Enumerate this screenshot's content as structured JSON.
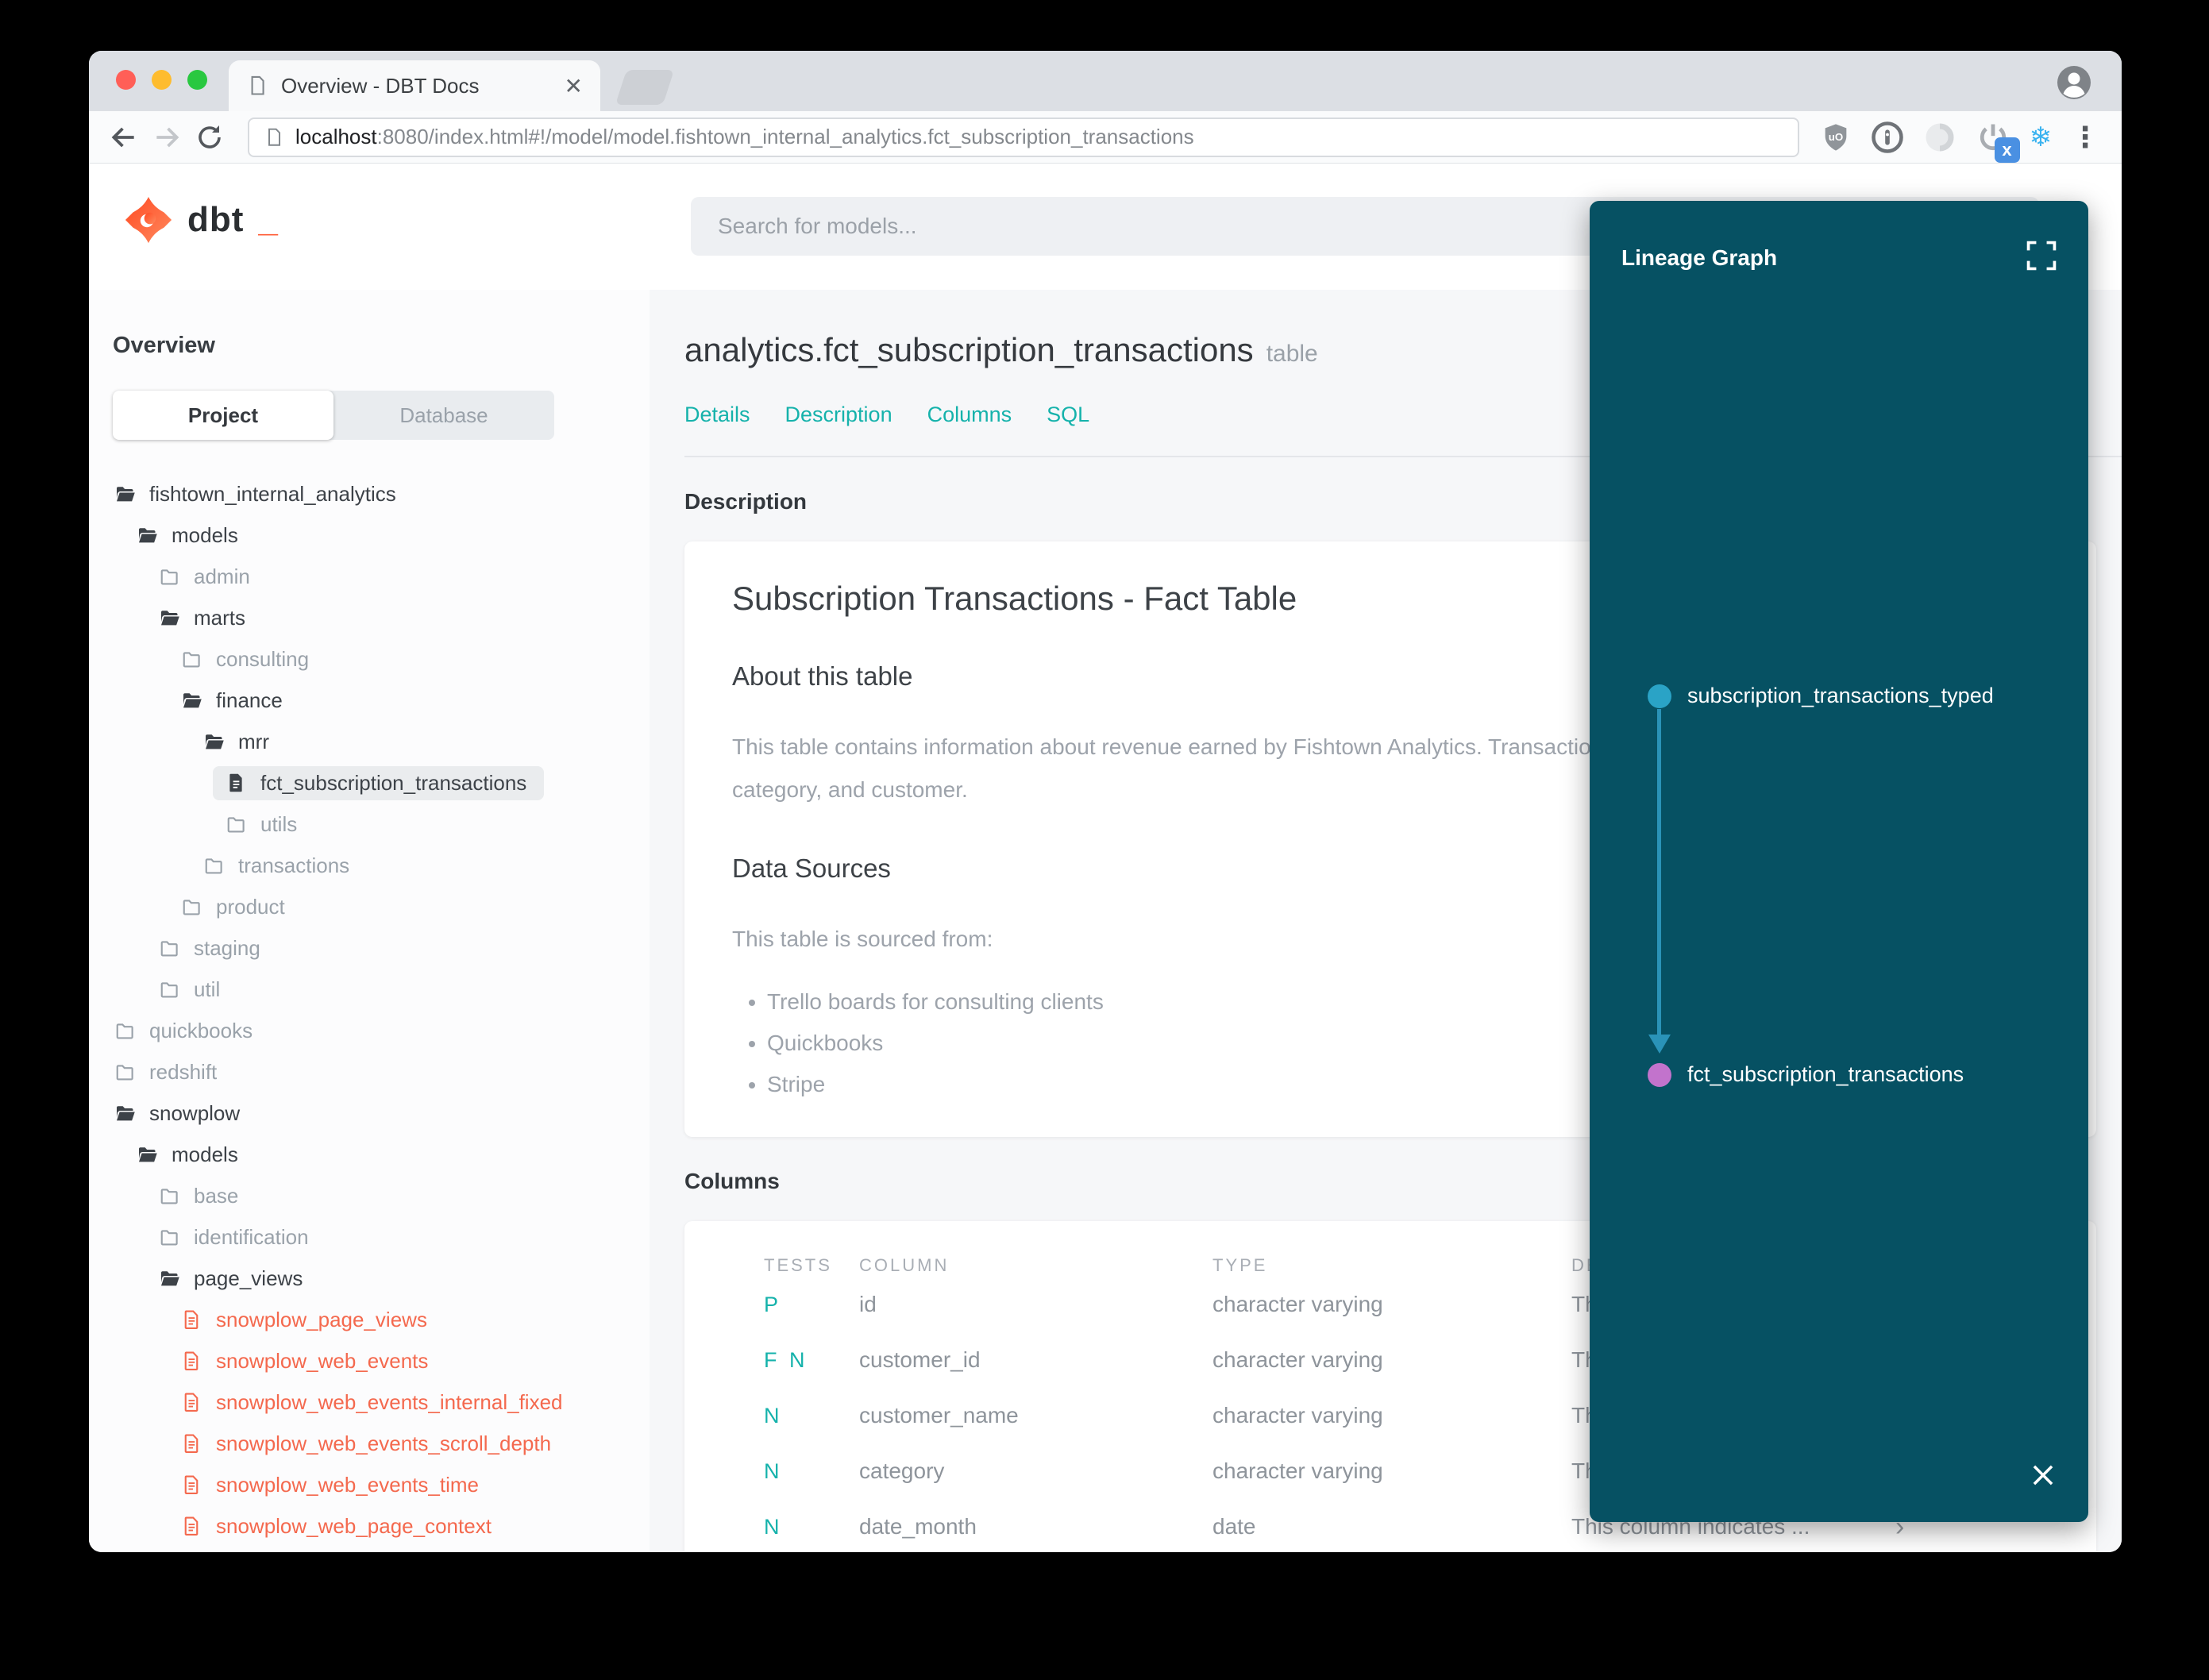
{
  "browser": {
    "tab_title": "Overview - DBT Docs",
    "url_host": "localhost",
    "url_rest": ":8080/index.html#!/model/model.fishtown_internal_analytics.fct_subscription_transactions"
  },
  "header": {
    "logo_text": "dbt",
    "logo_cursor": "_",
    "search_placeholder": "Search for models..."
  },
  "sidebar": {
    "overview_label": "Overview",
    "toggle": {
      "project": "Project",
      "database": "Database"
    },
    "tree": [
      {
        "label": "fishtown_internal_analytics",
        "level": 0,
        "icon": "folder-open",
        "tone": "dark"
      },
      {
        "label": "models",
        "level": 1,
        "icon": "folder-open",
        "tone": "dark"
      },
      {
        "label": "admin",
        "level": 2,
        "icon": "folder",
        "tone": "muted"
      },
      {
        "label": "marts",
        "level": 2,
        "icon": "folder-open",
        "tone": "dark"
      },
      {
        "label": "consulting",
        "level": 3,
        "icon": "folder",
        "tone": "muted"
      },
      {
        "label": "finance",
        "level": 3,
        "icon": "folder-open",
        "tone": "dark"
      },
      {
        "label": "mrr",
        "level": 4,
        "icon": "folder-open",
        "tone": "dark"
      },
      {
        "label": "fct_subscription_transactions",
        "level": 5,
        "icon": "file",
        "tone": "dark",
        "selected": true
      },
      {
        "label": "utils",
        "level": 5,
        "icon": "folder",
        "tone": "muted"
      },
      {
        "label": "transactions",
        "level": 4,
        "icon": "folder",
        "tone": "muted"
      },
      {
        "label": "product",
        "level": 3,
        "icon": "folder",
        "tone": "muted"
      },
      {
        "label": "staging",
        "level": 2,
        "icon": "folder",
        "tone": "muted"
      },
      {
        "label": "util",
        "level": 2,
        "icon": "folder",
        "tone": "muted"
      },
      {
        "label": "quickbooks",
        "level": 0,
        "icon": "folder",
        "tone": "muted"
      },
      {
        "label": "redshift",
        "level": 0,
        "icon": "folder",
        "tone": "muted"
      },
      {
        "label": "snowplow",
        "level": 0,
        "icon": "folder-open",
        "tone": "dark"
      },
      {
        "label": "models",
        "level": 1,
        "icon": "folder-open",
        "tone": "dark"
      },
      {
        "label": "base",
        "level": 2,
        "icon": "folder",
        "tone": "muted"
      },
      {
        "label": "identification",
        "level": 2,
        "icon": "folder",
        "tone": "muted"
      },
      {
        "label": "page_views",
        "level": 2,
        "icon": "folder-open",
        "tone": "dark"
      },
      {
        "label": "snowplow_page_views",
        "level": 3,
        "icon": "file-outline",
        "tone": "accent"
      },
      {
        "label": "snowplow_web_events",
        "level": 3,
        "icon": "file-outline",
        "tone": "accent"
      },
      {
        "label": "snowplow_web_events_internal_fixed",
        "level": 3,
        "icon": "file-outline",
        "tone": "accent"
      },
      {
        "label": "snowplow_web_events_scroll_depth",
        "level": 3,
        "icon": "file-outline",
        "tone": "accent"
      },
      {
        "label": "snowplow_web_events_time",
        "level": 3,
        "icon": "file-outline",
        "tone": "accent"
      },
      {
        "label": "snowplow_web_page_context",
        "level": 3,
        "icon": "file-outline",
        "tone": "accent"
      }
    ]
  },
  "model": {
    "title": "analytics.fct_subscription_transactions",
    "title_suffix": "table",
    "nav": [
      "Details",
      "Description",
      "Columns",
      "SQL"
    ]
  },
  "description": {
    "section_label": "Description",
    "heading": "Subscription Transactions - Fact Table",
    "about_heading": "About this table",
    "about_text": "This table contains information about revenue earned by Fishtown Analytics. Transactions are segmented by revenue stream,\ncategory, and customer.",
    "sources_heading": "Data Sources",
    "sources_intro": "This table is sourced from:",
    "sources": [
      "Trello boards for consulting clients",
      "Quickbooks",
      "Stripe"
    ]
  },
  "columns": {
    "section_label": "Columns",
    "headers": [
      "TESTS",
      "COLUMN",
      "TYPE",
      "DESCRIPTION"
    ],
    "rows": [
      {
        "tests": "P",
        "column": "id",
        "type": "character varying",
        "description": "This column indicates ..."
      },
      {
        "tests": "F N",
        "column": "customer_id",
        "type": "character varying",
        "description": "This column indicates ..."
      },
      {
        "tests": "N",
        "column": "customer_name",
        "type": "character varying",
        "description": "This column indicates ..."
      },
      {
        "tests": "N",
        "column": "category",
        "type": "character varying",
        "description": "This column indicates ..."
      },
      {
        "tests": "N",
        "column": "date_month",
        "type": "date",
        "description": "This column indicates ..."
      }
    ]
  },
  "lineage": {
    "title": "Lineage Graph",
    "nodes": [
      {
        "label": "subscription_transactions_typed",
        "color": "#2aa3c6"
      },
      {
        "label": "fct_subscription_transactions",
        "color": "#c273cc"
      }
    ]
  },
  "colors": {
    "accent_teal": "#15b2ab",
    "accent_orange": "#f4694e",
    "lineage_panel_bg": "#065163",
    "lineage_edge": "#2a93b8"
  }
}
